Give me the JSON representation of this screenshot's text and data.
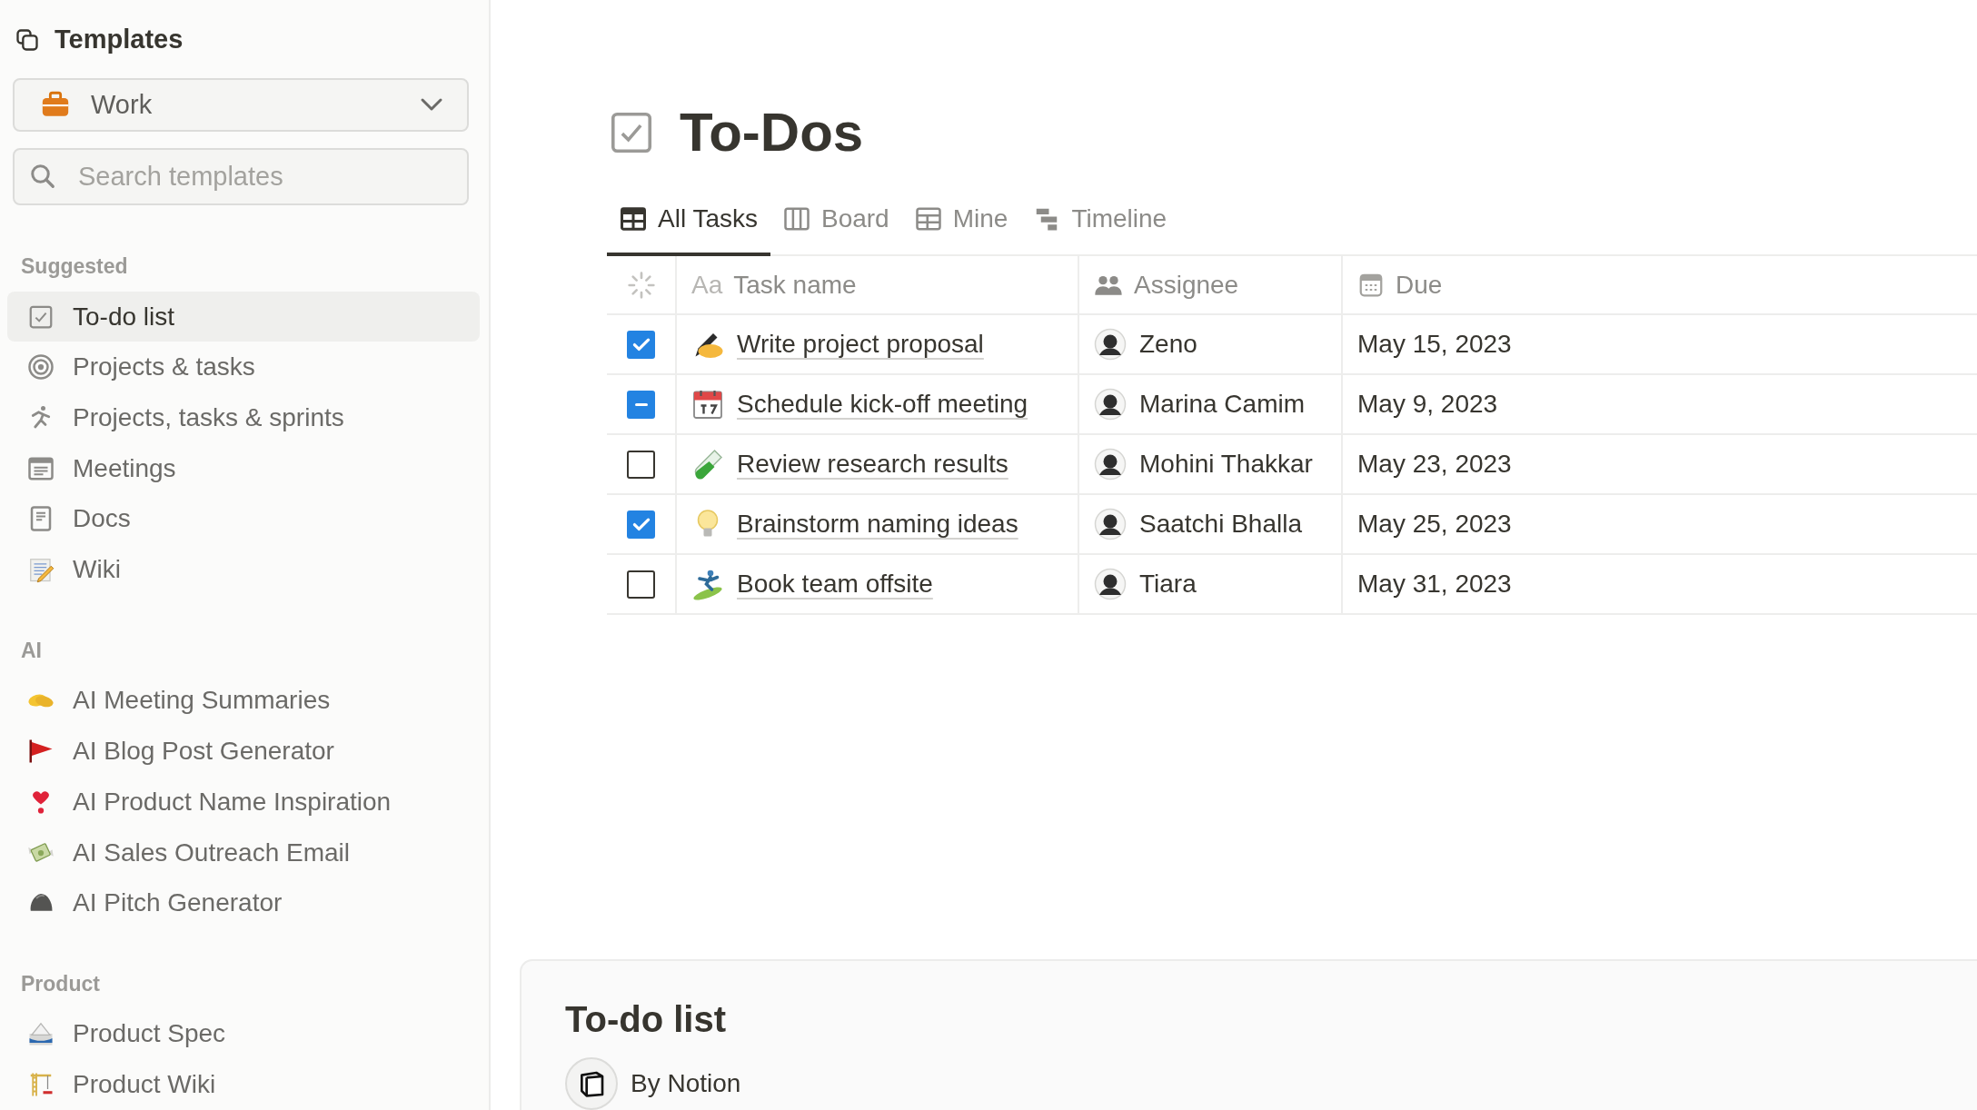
{
  "sidebar": {
    "title": "Templates",
    "category_dropdown": {
      "value": "Work"
    },
    "search": {
      "placeholder": "Search templates"
    },
    "sections": [
      {
        "heading": "Suggested",
        "items": [
          {
            "label": "To-do list",
            "selected": true
          },
          {
            "label": "Projects & tasks",
            "selected": false
          },
          {
            "label": "Projects, tasks & sprints",
            "selected": false
          },
          {
            "label": "Meetings",
            "selected": false
          },
          {
            "label": "Docs",
            "selected": false
          },
          {
            "label": "Wiki",
            "selected": false
          }
        ]
      },
      {
        "heading": "AI",
        "items": [
          {
            "label": "AI Meeting Summaries",
            "selected": false
          },
          {
            "label": "AI Blog Post Generator",
            "selected": false
          },
          {
            "label": "AI Product Name Inspiration",
            "selected": false
          },
          {
            "label": "AI Sales Outreach Email",
            "selected": false
          },
          {
            "label": "AI Pitch Generator",
            "selected": false
          }
        ]
      },
      {
        "heading": "Product",
        "items": [
          {
            "label": "Product Spec",
            "selected": false
          },
          {
            "label": "Product Wiki",
            "selected": false
          }
        ]
      }
    ]
  },
  "page": {
    "title": "To-Dos",
    "tabs": [
      {
        "label": "All Tasks",
        "selected": true
      },
      {
        "label": "Board",
        "selected": false
      },
      {
        "label": "Mine",
        "selected": false
      },
      {
        "label": "Timeline",
        "selected": false
      }
    ],
    "table": {
      "columns": [
        {
          "prefix": "Aa",
          "label": "Task name"
        },
        {
          "label": "Assignee"
        },
        {
          "label": "Due"
        }
      ],
      "rows": [
        {
          "checked": true,
          "task": "Write project proposal",
          "assignee": "Zeno",
          "due": "May 15, 2023"
        },
        {
          "checked": true,
          "indeterminate": true,
          "task": "Schedule kick-off meeting",
          "assignee": "Marina Camim",
          "due": "May 9, 2023"
        },
        {
          "checked": false,
          "task": "Review research results",
          "assignee": "Mohini Thakkar",
          "due": "May 23, 2023"
        },
        {
          "checked": true,
          "task": "Brainstorm naming ideas",
          "assignee": "Saatchi Bhalla",
          "due": "May 25, 2023"
        },
        {
          "checked": false,
          "task": "Book team offsite",
          "assignee": "Tiara",
          "due": "May 31, 2023"
        }
      ]
    }
  },
  "preview_card": {
    "title": "To-do list",
    "author": "By Notion"
  }
}
